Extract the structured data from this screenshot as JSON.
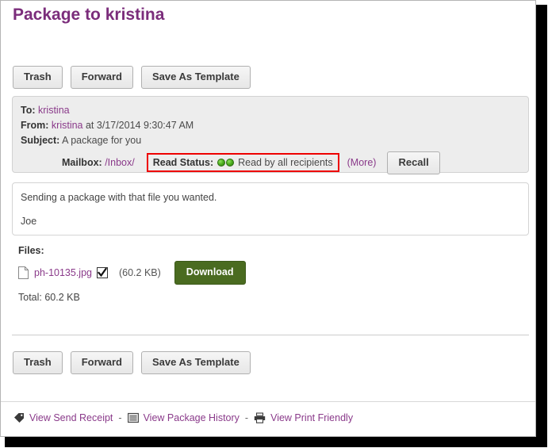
{
  "page": {
    "title": "Package to kristina"
  },
  "toolbar": {
    "trash_label": "Trash",
    "forward_label": "Forward",
    "save_template_label": "Save As Template"
  },
  "info_panel": {
    "to_label": "To:",
    "to_value": "kristina",
    "from_label": "From:",
    "from_value": "kristina",
    "from_suffix": "at 3/17/2014 9:30:47 AM",
    "subject_label": "Subject:",
    "subject_value": "A package for you",
    "mailbox_label": "Mailbox:",
    "mailbox_value": "/Inbox/",
    "read_status_label": "Read Status:",
    "read_status_text": "Read by all recipients",
    "read_status_dots": 2,
    "more_link": "(More)",
    "recall_label": "Recall",
    "highlight_color": "#ee0000",
    "panel_bg": "#ededed"
  },
  "message": {
    "line1": "Sending a package with that file you wanted.",
    "line2": "Joe"
  },
  "files": {
    "heading": "Files:",
    "file_name": "ph-10135.jpg",
    "file_size": "(60.2 KB)",
    "download_label": "Download",
    "download_color": "#4a6b20",
    "total_label": "Total: 60.2 KB"
  },
  "footer": {
    "send_receipt_label": "View Send Receipt",
    "package_history_label": "View Package History",
    "print_friendly_label": "View Print Friendly",
    "separator": "-",
    "link_color": "#8a3a8a"
  }
}
